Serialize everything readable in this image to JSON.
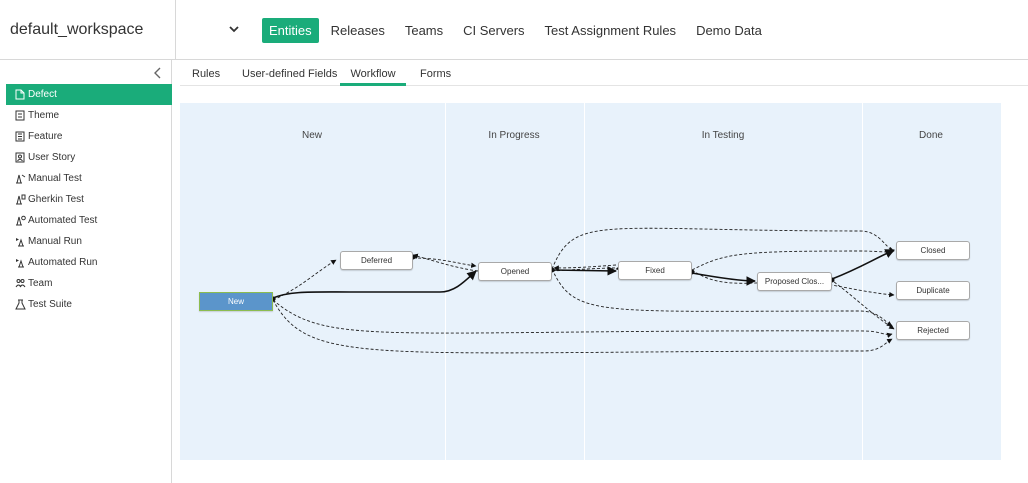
{
  "workspace": {
    "name": "default_workspace",
    "dropdown_icon": "chevron-down-icon"
  },
  "top_nav": [
    {
      "label": "Entities",
      "active": true
    },
    {
      "label": "Releases"
    },
    {
      "label": "Teams"
    },
    {
      "label": "CI Servers"
    },
    {
      "label": "Test Assignment Rules"
    },
    {
      "label": "Demo Data"
    }
  ],
  "sidebar": {
    "collapse_icon": "chevron-left-icon",
    "items": [
      {
        "label": "Defect",
        "icon": "defect-icon",
        "active": true
      },
      {
        "label": "Theme",
        "icon": "theme-icon"
      },
      {
        "label": "Feature",
        "icon": "feature-icon"
      },
      {
        "label": "User Story",
        "icon": "user-story-icon"
      },
      {
        "label": "Manual Test",
        "icon": "manual-test-icon"
      },
      {
        "label": "Gherkin Test",
        "icon": "gherkin-test-icon"
      },
      {
        "label": "Automated Test",
        "icon": "automated-test-icon"
      },
      {
        "label": "Manual Run",
        "icon": "manual-run-icon"
      },
      {
        "label": "Automated Run",
        "icon": "automated-run-icon"
      },
      {
        "label": "Team",
        "icon": "team-icon"
      },
      {
        "label": "Test Suite",
        "icon": "test-suite-icon"
      }
    ]
  },
  "sub_tabs": [
    {
      "label": "Rules"
    },
    {
      "label": "User-defined Fields"
    },
    {
      "label": "Workflow",
      "active": true
    },
    {
      "label": "Forms"
    }
  ],
  "workflow": {
    "columns": [
      {
        "label": "New"
      },
      {
        "label": "In Progress"
      },
      {
        "label": "In Testing"
      },
      {
        "label": "Done"
      }
    ],
    "nodes": {
      "new": "New",
      "deferred": "Deferred",
      "opened": "Opened",
      "fixed": "Fixed",
      "proposed_close": "Proposed Clos...",
      "closed": "Closed",
      "duplicate": "Duplicate",
      "rejected": "Rejected"
    }
  },
  "colors": {
    "accent": "#1aac7a",
    "canvas_bg": "#e8f2fb",
    "start_node": "#5b95cb"
  }
}
